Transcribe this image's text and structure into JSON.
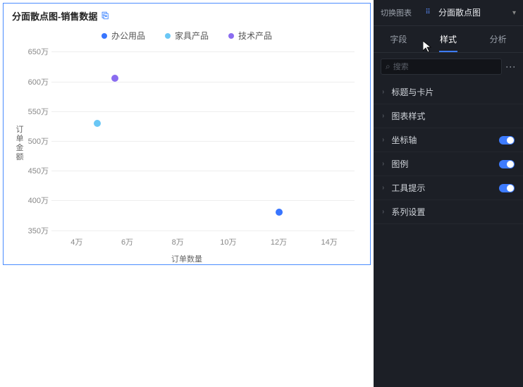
{
  "chart_data": {
    "type": "scatter",
    "title": "分面散点图-销售数据",
    "xlabel": "订单数量",
    "ylabel": "订单金额",
    "x_ticks": [
      "4万",
      "6万",
      "8万",
      "10万",
      "12万",
      "14万"
    ],
    "y_ticks": [
      "350万",
      "400万",
      "450万",
      "500万",
      "550万",
      "600万",
      "650万"
    ],
    "xlim": [
      30000,
      150000
    ],
    "ylim": [
      340000,
      660000
    ],
    "series": [
      {
        "name": "办公用品",
        "color": "#3875ff",
        "points": [
          {
            "x": 120000,
            "y": 380
          }
        ]
      },
      {
        "name": "家具产品",
        "color": "#6ac7f5",
        "points": [
          {
            "x": 48000,
            "y": 530
          }
        ]
      },
      {
        "name": "技术产品",
        "color": "#8a6cf0",
        "points": [
          {
            "x": 55000,
            "y": 605
          }
        ]
      }
    ]
  },
  "sidebar": {
    "switch_label": "切换图表",
    "chart_type_label": "分面散点图",
    "tabs": {
      "fields": "字段",
      "style": "样式",
      "analysis": "分析",
      "active": "style"
    },
    "search_placeholder": "搜索",
    "sections": [
      {
        "label": "标题与卡片",
        "toggle": null
      },
      {
        "label": "图表样式",
        "toggle": null
      },
      {
        "label": "坐标轴",
        "toggle": true
      },
      {
        "label": "图例",
        "toggle": true
      },
      {
        "label": "工具提示",
        "toggle": true
      },
      {
        "label": "系列设置",
        "toggle": null
      }
    ]
  }
}
